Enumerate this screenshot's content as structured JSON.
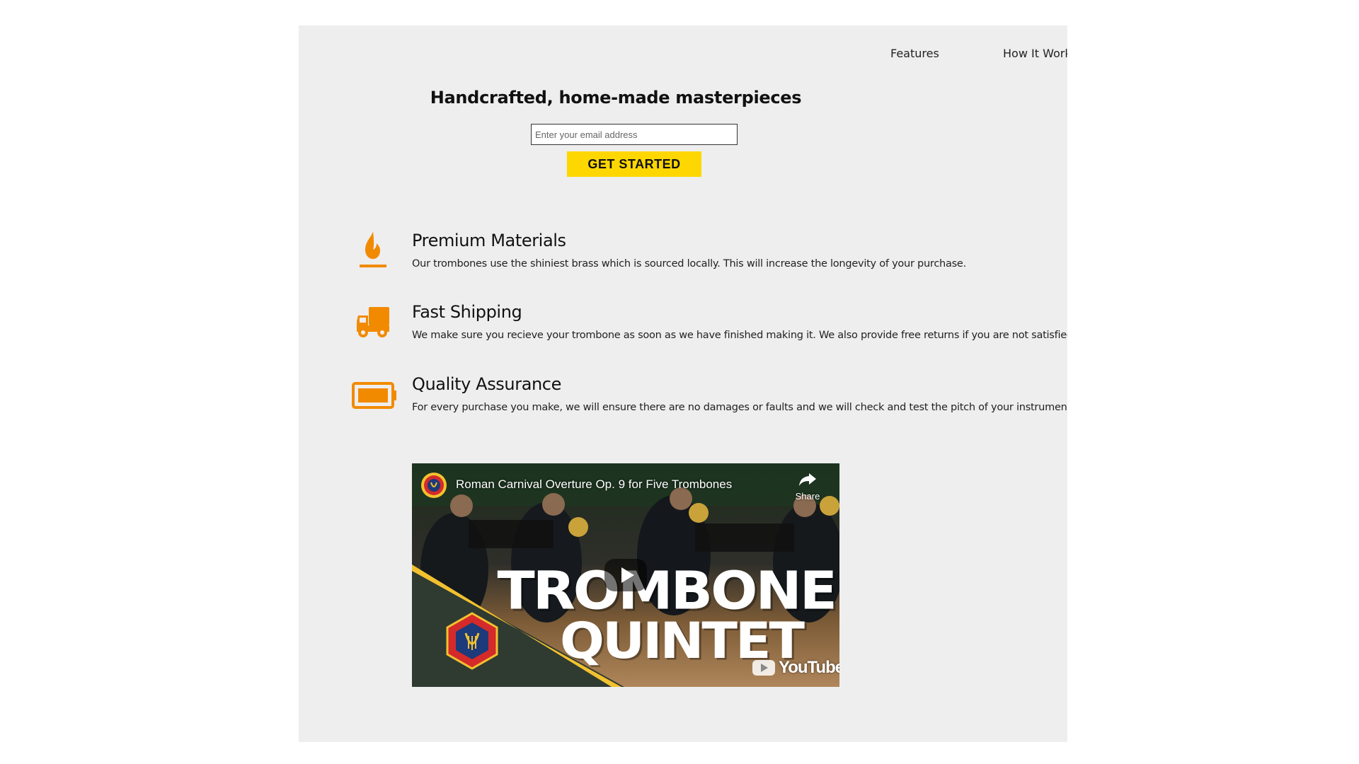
{
  "nav": {
    "items": [
      {
        "label": "Features"
      },
      {
        "label": "How It Work"
      }
    ]
  },
  "hero": {
    "title": "Handcrafted, home-made masterpieces",
    "email_placeholder": "Enter your email address",
    "cta_label": "GET STARTED"
  },
  "features": [
    {
      "icon": "fire-icon",
      "title": "Premium Materials",
      "description": "Our trombones use the shiniest brass which is sourced locally. This will increase the longevity of your purchase."
    },
    {
      "icon": "truck-icon",
      "title": "Fast Shipping",
      "description": "We make sure you recieve your trombone as soon as we have finished making it. We also provide free returns if you are not satisfied."
    },
    {
      "icon": "battery-icon",
      "title": "Quality Assurance",
      "description": "For every purchase you make, we will ensure there are no damages or faults and we will check and test the pitch of your instrument."
    }
  ],
  "video": {
    "title": "Roman Carnival Overture Op. 9 for Five Trombones",
    "share_label": "Share",
    "thumbnail_line1": "TROMBONE",
    "thumbnail_line2": "QUINTET",
    "platform": "YouTube"
  },
  "colors": {
    "page_background": "#eeeeee",
    "accent_orange": "#f28a00",
    "cta_yellow": "#ffd700",
    "text_dark": "#111111"
  }
}
